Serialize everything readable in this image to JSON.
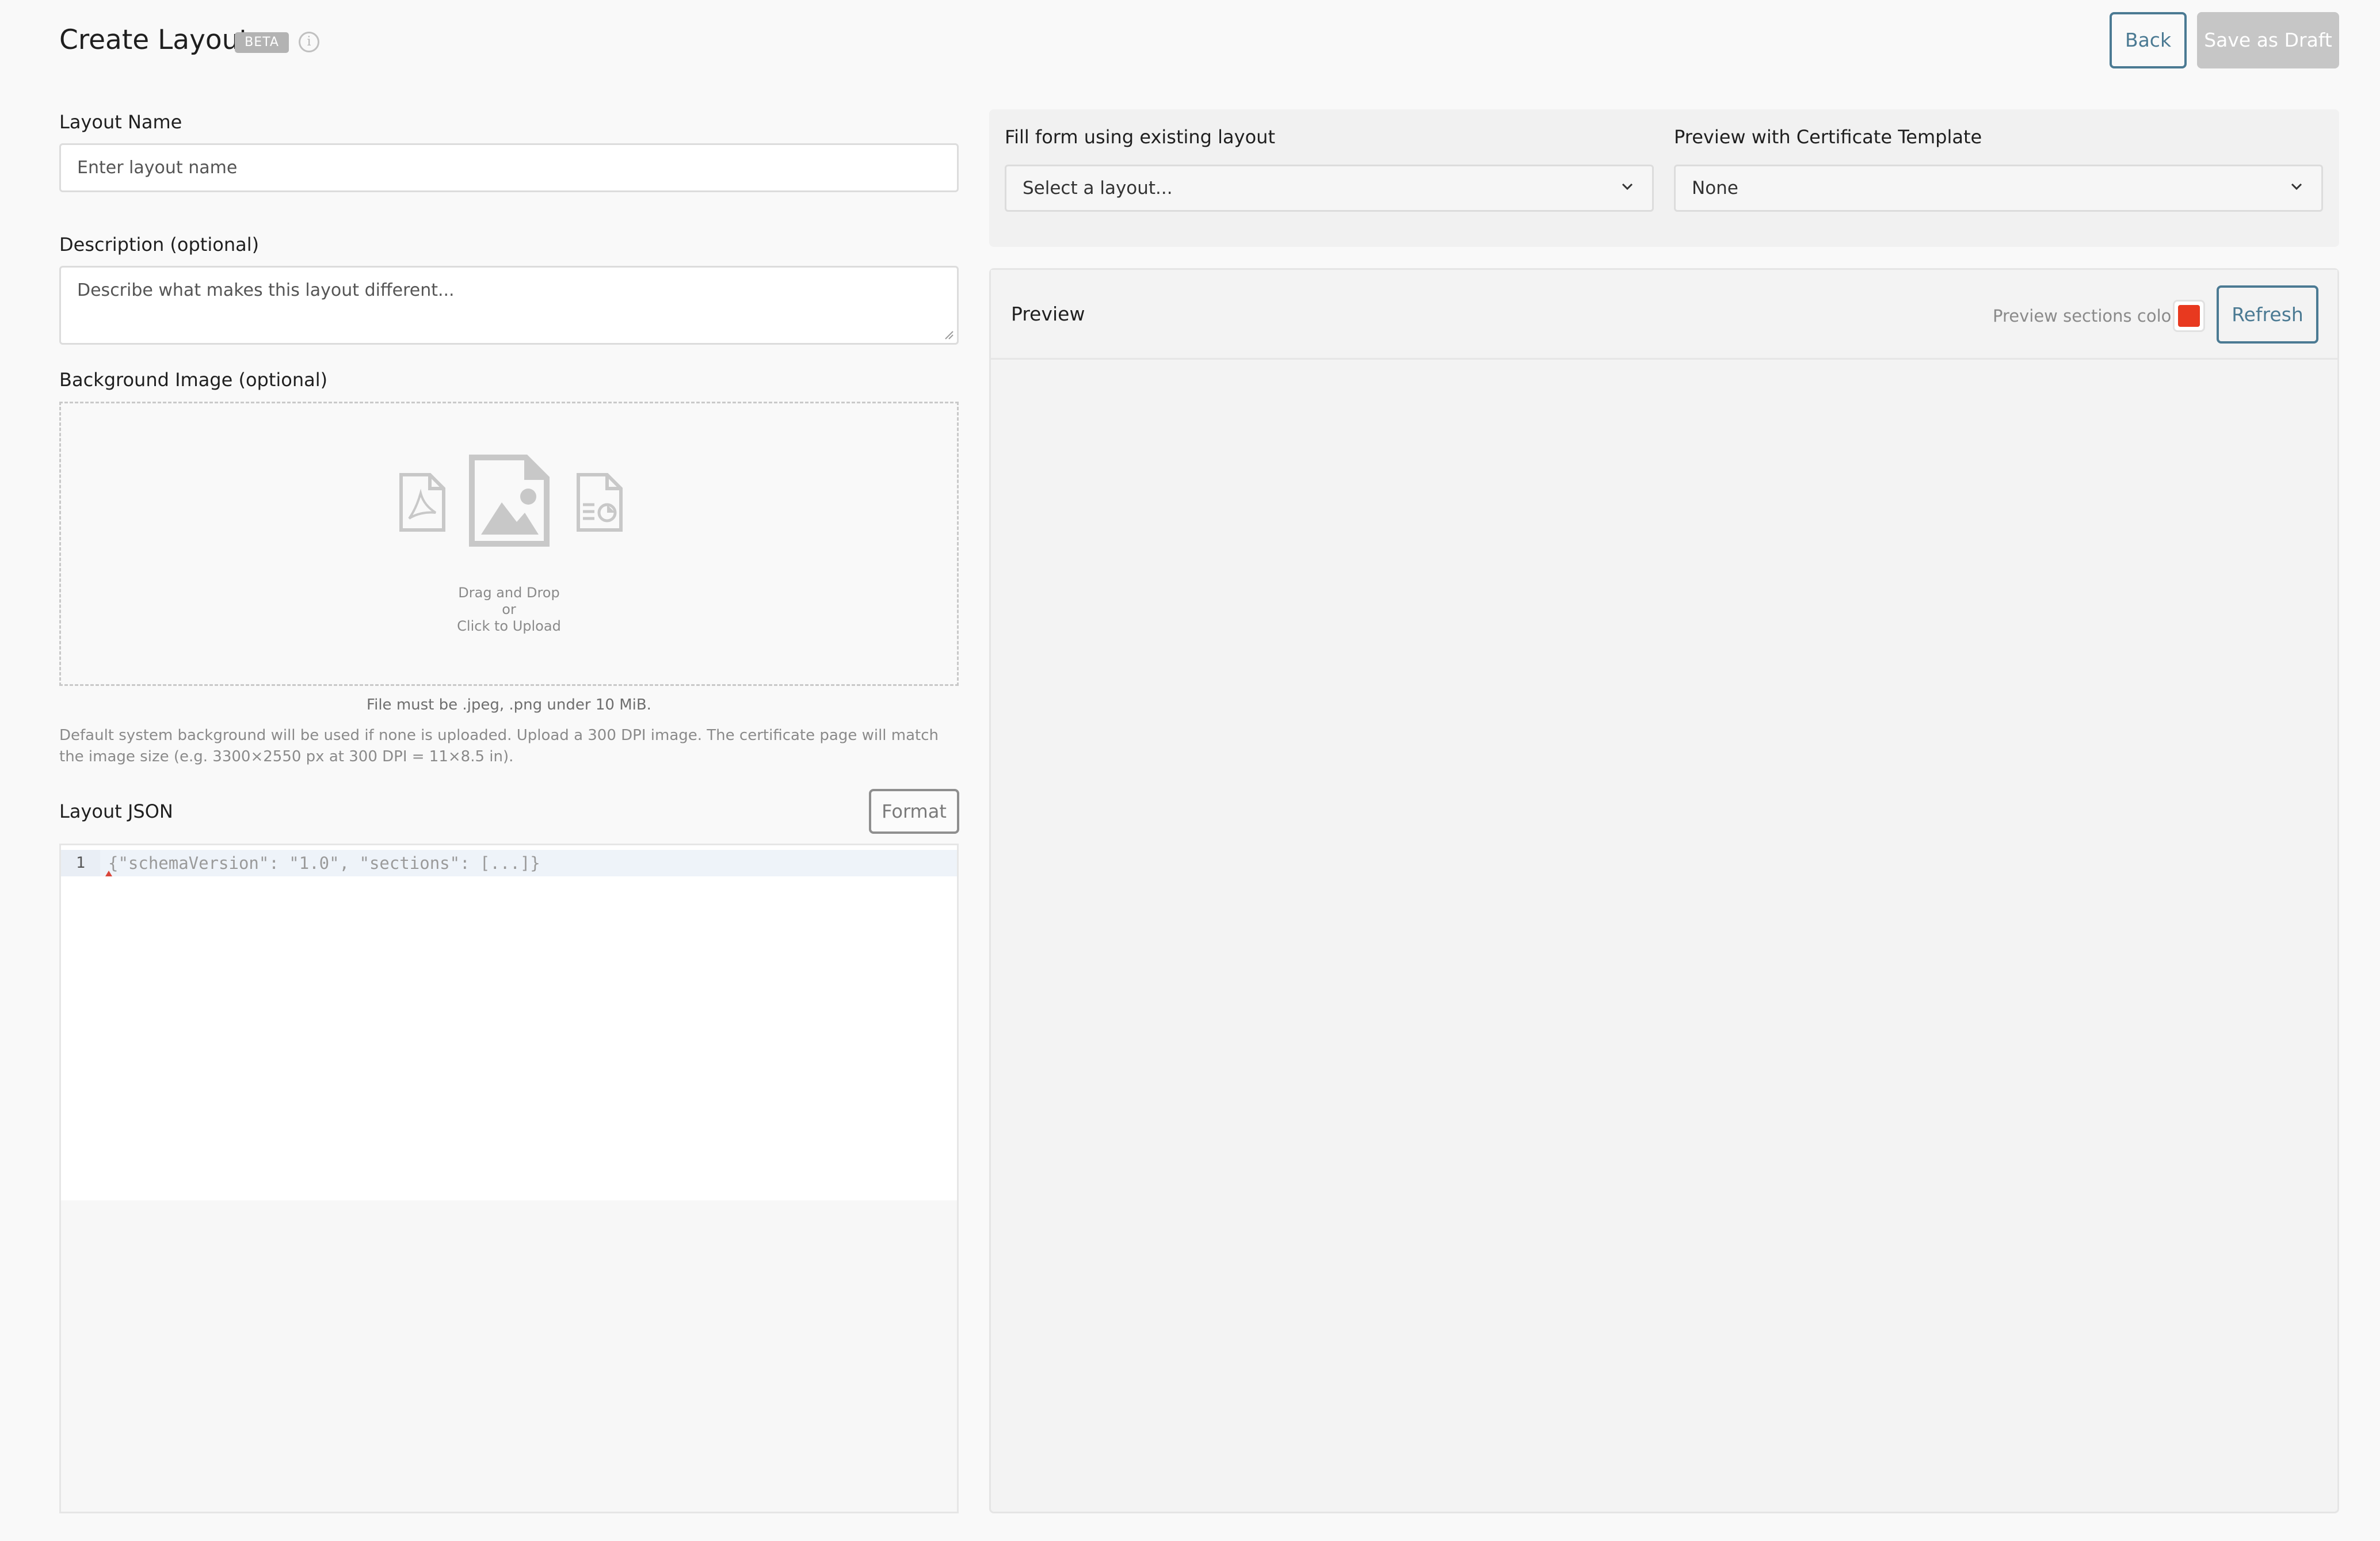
{
  "header": {
    "title": "Create Layout",
    "badge": "BETA",
    "info_glyph": "i",
    "back_label": "Back",
    "save_draft_label": "Save as Draft"
  },
  "form": {
    "layout_name": {
      "label": "Layout Name",
      "placeholder": "Enter layout name"
    },
    "description": {
      "label": "Description (optional)",
      "placeholder": "Describe what makes this layout different..."
    },
    "background": {
      "label": "Background Image (optional)",
      "upload_lines": [
        "Drag and Drop",
        "or",
        "Click to Upload"
      ],
      "file_hint": "File must be .jpeg, .png under 10 MiB.",
      "default_note": "Default system background will be used if none is uploaded. Upload a 300 DPI image. The certificate page will match the image size (e.g. 3300×2550 px at 300 DPI = 11×8.5 in).",
      "icons": [
        "pdf-file-icon",
        "image-file-icon",
        "document-chart-icon"
      ]
    },
    "layout_json": {
      "label": "Layout JSON",
      "format_label": "Format",
      "line_number": "1",
      "placeholder_code": "{\"schemaVersion\": \"1.0\", \"sections\": [...]}"
    }
  },
  "fill_form": {
    "existing_layout": {
      "label": "Fill form using existing layout",
      "selected": "Select a layout..."
    },
    "certificate_template": {
      "label": "Preview with Certificate Template",
      "selected": "None"
    }
  },
  "preview": {
    "title": "Preview",
    "sections_color_label": "Preview sections color",
    "sections_color": "#e8391f",
    "refresh_label": "Refresh"
  },
  "colors": {
    "accent": "#4b7a93",
    "disabled_button": "#c6c6c6",
    "background": "#f9f9f9"
  }
}
